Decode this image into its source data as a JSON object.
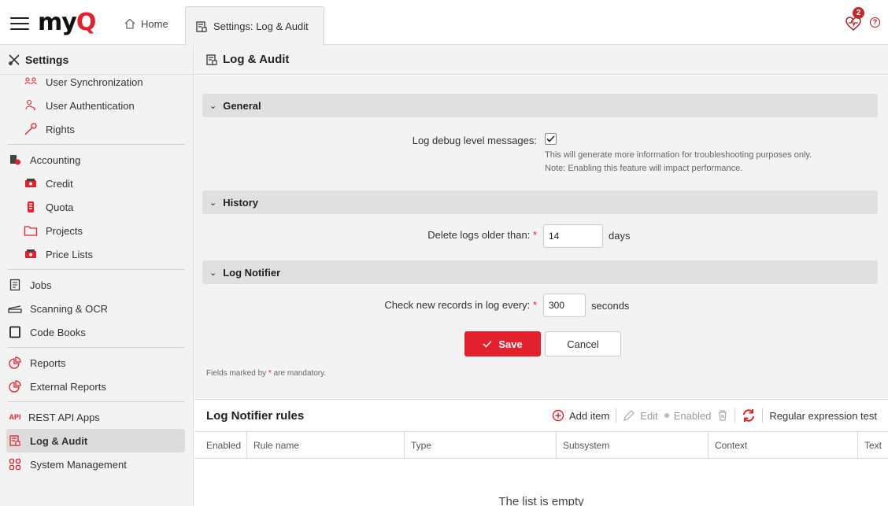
{
  "app": {
    "logo_main": "my",
    "logo_accent": "Q",
    "home_label": "Home",
    "active_tab_label": "Settings: Log & Audit",
    "notification_count": "2",
    "help_glyph": "?",
    "accent_color": "#e2202e"
  },
  "sidebar": {
    "title": "Settings",
    "items": [
      {
        "label": "User Synchronization",
        "icon": "users-sync-icon",
        "sub": true
      },
      {
        "label": "User Authentication",
        "icon": "user-key-icon",
        "sub": true
      },
      {
        "label": "Rights",
        "icon": "key-icon",
        "sub": true
      },
      {
        "label": "Accounting",
        "icon": "accounting-icon",
        "sub": false
      },
      {
        "label": "Credit",
        "icon": "credit-icon",
        "sub": true
      },
      {
        "label": "Quota",
        "icon": "quota-icon",
        "sub": true
      },
      {
        "label": "Projects",
        "icon": "folder-icon",
        "sub": true
      },
      {
        "label": "Price Lists",
        "icon": "price-list-icon",
        "sub": true
      },
      {
        "label": "Jobs",
        "icon": "document-icon",
        "sub": false
      },
      {
        "label": "Scanning & OCR",
        "icon": "scanner-icon",
        "sub": false
      },
      {
        "label": "Code Books",
        "icon": "book-icon",
        "sub": false
      },
      {
        "label": "Reports",
        "icon": "pie-chart-icon",
        "sub": false
      },
      {
        "label": "External Reports",
        "icon": "pie-chart-icon",
        "sub": false
      },
      {
        "label": "REST API Apps",
        "icon": "api-icon",
        "icon_text": "API",
        "sub": false
      },
      {
        "label": "Log & Audit",
        "icon": "log-audit-icon",
        "sub": false,
        "active": true
      },
      {
        "label": "System Management",
        "icon": "grid-icon",
        "sub": false
      }
    ]
  },
  "main": {
    "title": "Log & Audit",
    "sections": {
      "general": "General",
      "history": "History",
      "log_notifier": "Log Notifier"
    },
    "general": {
      "debug_label": "Log debug level messages:",
      "debug_checked": true,
      "hint_line1": "This will generate more information for troubleshooting purposes only.",
      "hint_line2": "Note: Enabling this feature will impact performance."
    },
    "history": {
      "delete_label": "Delete logs older than:",
      "delete_value": "14",
      "delete_unit": "days"
    },
    "notifier": {
      "check_label": "Check new records in log every:",
      "check_value": "300",
      "check_unit": "seconds"
    },
    "required_mark": "*",
    "save_label": "Save",
    "cancel_label": "Cancel",
    "mandatory_prefix": "Fields marked by",
    "mandatory_suffix": "are mandatory."
  },
  "rules": {
    "title": "Log Notifier rules",
    "toolbar": {
      "add": "Add item",
      "edit": "Edit",
      "enabled": "Enabled",
      "regex": "Regular expression test"
    },
    "columns": [
      "Enabled",
      "Rule name",
      "Type",
      "Subsystem",
      "Context",
      "Text"
    ],
    "empty_message": "The list is empty"
  }
}
